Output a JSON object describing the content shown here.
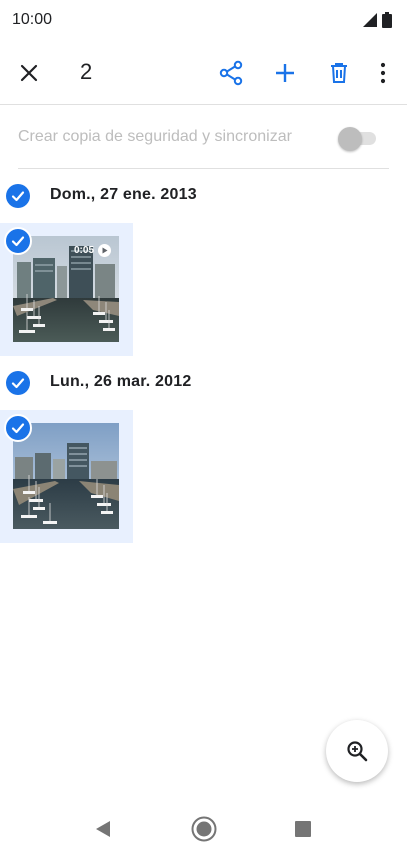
{
  "status": {
    "time": "10:00"
  },
  "toolbar": {
    "selected_count": "2"
  },
  "backup": {
    "label": "Crear copia de seguridad y sincronizar",
    "enabled": false
  },
  "groups": [
    {
      "date": "Dom., 27 ene. 2013",
      "item": {
        "type": "video",
        "duration": "0:05",
        "selected": true
      }
    },
    {
      "date": "Lun., 26 mar. 2012",
      "item": {
        "type": "photo",
        "selected": true
      }
    }
  ],
  "colors": {
    "accent": "#1a73e8",
    "selection_bg": "#e8f0fe",
    "disabled_text": "#bdbdbd"
  },
  "icons": {
    "close": "close-icon",
    "share": "share-icon",
    "add": "add-icon",
    "delete": "delete-icon",
    "more": "more-vert-icon",
    "zoom": "zoom-in-icon",
    "back": "nav-back-icon",
    "home": "nav-home-icon",
    "recents": "nav-recents-icon"
  }
}
